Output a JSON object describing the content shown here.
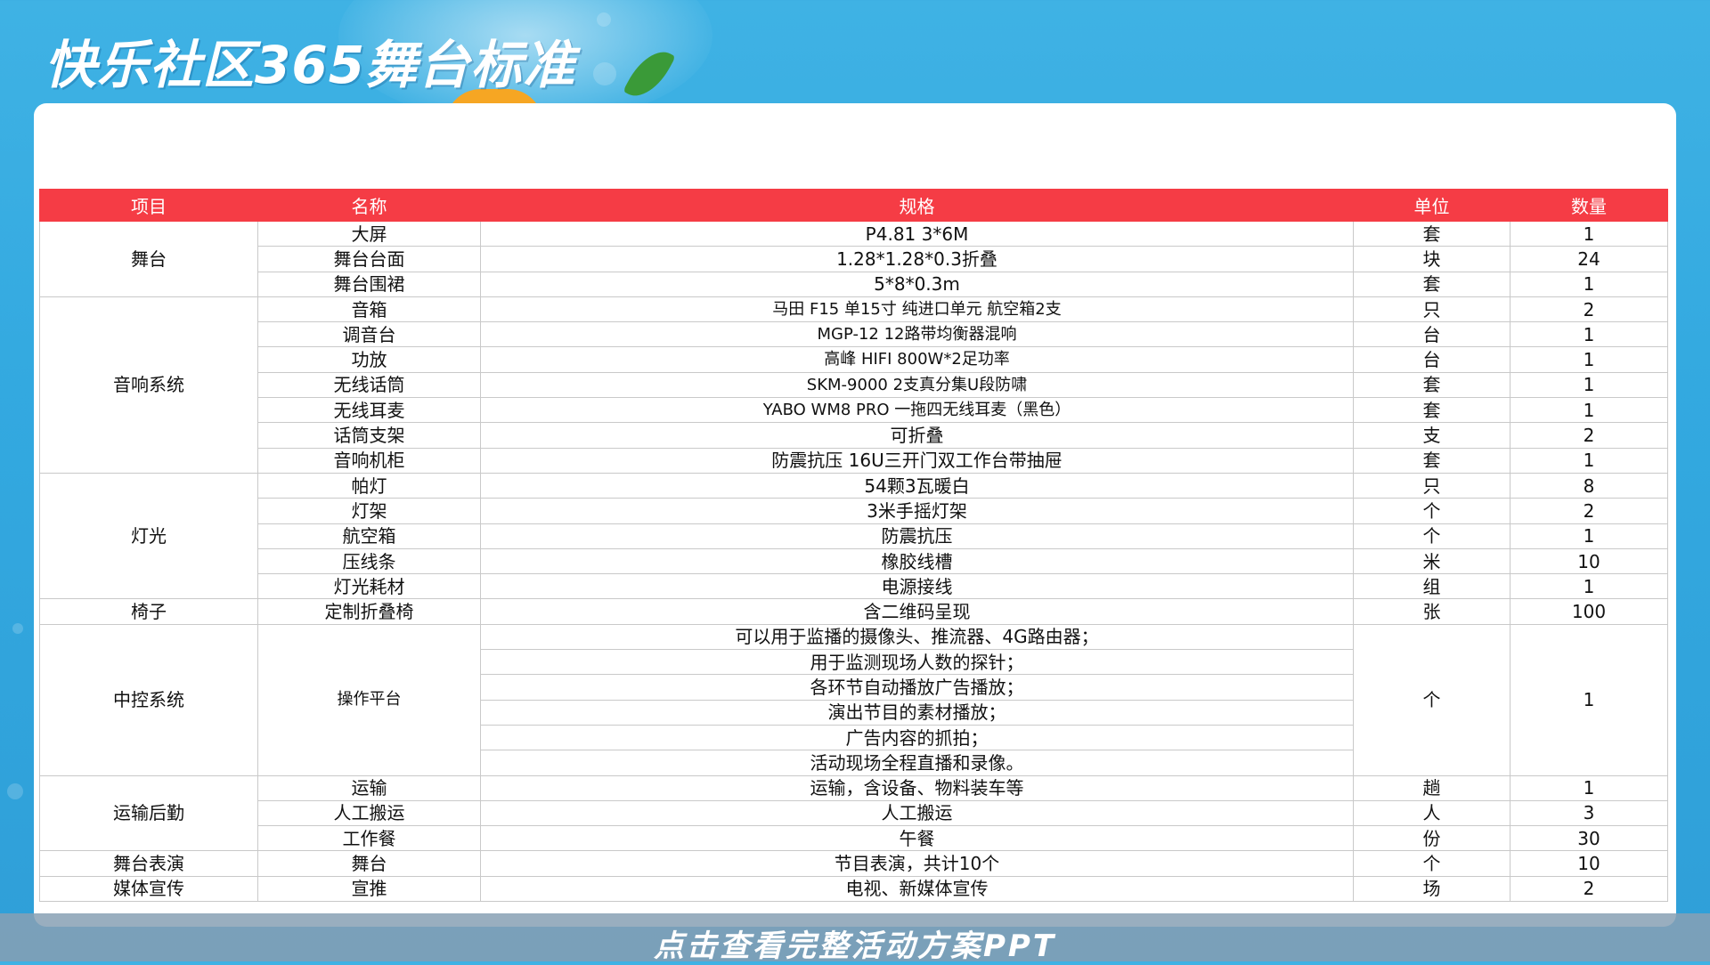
{
  "title": "快乐社区365舞台标准",
  "footer": "点击查看完整活动方案PPT",
  "colors": {
    "header_bg": "#f53c45",
    "page_bg": "#33a9e0",
    "card_bg": "#ffffff"
  },
  "table": {
    "headers": [
      "项目",
      "名称",
      "规格",
      "单位",
      "数量"
    ],
    "groups": [
      {
        "category": "舞台",
        "rows": [
          {
            "name": "大屏",
            "spec": "P4.81  3*6M",
            "unit": "套",
            "qty": "1"
          },
          {
            "name": "舞台台面",
            "spec": "1.28*1.28*0.3折叠",
            "unit": "块",
            "qty": "24"
          },
          {
            "name": "舞台围裙",
            "spec": "5*8*0.3m",
            "unit": "套",
            "qty": "1"
          }
        ]
      },
      {
        "category": "音响系统",
        "rows": [
          {
            "name": "音箱",
            "spec": "马田 F15 单15寸 纯进口单元 航空箱2支",
            "unit": "只",
            "qty": "2"
          },
          {
            "name": "调音台",
            "spec": "MGP-12 12路带均衡器混响",
            "unit": "台",
            "qty": "1"
          },
          {
            "name": "功放",
            "spec": "高峰 HIFI  800W*2足功率",
            "unit": "台",
            "qty": "1"
          },
          {
            "name": "无线话筒",
            "spec": "SKM-9000  2支真分集U段防啸",
            "unit": "套",
            "qty": "1"
          },
          {
            "name": "无线耳麦",
            "spec": "YABO WM8 PRO 一拖四无线耳麦（黑色）",
            "unit": "套",
            "qty": "1"
          },
          {
            "name": "话筒支架",
            "spec": "可折叠",
            "unit": "支",
            "qty": "2"
          },
          {
            "name": "音响机柜",
            "spec": "防震抗压 16U三开门双工作台带抽屉",
            "unit": "套",
            "qty": "1"
          }
        ]
      },
      {
        "category": "灯光",
        "rows": [
          {
            "name": "帕灯",
            "spec": "54颗3瓦暖白",
            "unit": "只",
            "qty": "8"
          },
          {
            "name": "灯架",
            "spec": "3米手摇灯架",
            "unit": "个",
            "qty": "2"
          },
          {
            "name": "航空箱",
            "spec": "防震抗压",
            "unit": "个",
            "qty": "1"
          },
          {
            "name": "压线条",
            "spec": "橡胶线槽",
            "unit": "米",
            "qty": "10"
          },
          {
            "name": "灯光耗材",
            "spec": "电源接线",
            "unit": "组",
            "qty": "1"
          }
        ]
      },
      {
        "category": "椅子",
        "rows": [
          {
            "name": "定制折叠椅",
            "spec": "含二维码呈现",
            "unit": "张",
            "qty": "100"
          }
        ]
      },
      {
        "category": "中控系统",
        "name": "操作平台",
        "unit": "个",
        "qty": "1",
        "specs": [
          "可以用于监播的摄像头、推流器、4G路由器；",
          "用于监测现场人数的探针；",
          "各环节自动播放广告播放；",
          "演出节目的素材播放；",
          "广告内容的抓拍；",
          "活动现场全程直播和录像。"
        ]
      },
      {
        "category": "运输后勤",
        "rows": [
          {
            "name": "运输",
            "spec": "运输，含设备、物料装车等",
            "unit": "趟",
            "qty": "1"
          },
          {
            "name": "人工搬运",
            "spec": "人工搬运",
            "unit": "人",
            "qty": "3"
          },
          {
            "name": "工作餐",
            "spec": "午餐",
            "unit": "份",
            "qty": "30"
          }
        ]
      },
      {
        "category": "舞台表演",
        "rows": [
          {
            "name": "舞台",
            "spec": "节目表演，共计10个",
            "unit": "个",
            "qty": "10"
          }
        ]
      },
      {
        "category": "媒体宣传",
        "rows": [
          {
            "name": "宣推",
            "spec": "电视、新媒体宣传",
            "unit": "场",
            "qty": "2"
          }
        ]
      }
    ]
  }
}
